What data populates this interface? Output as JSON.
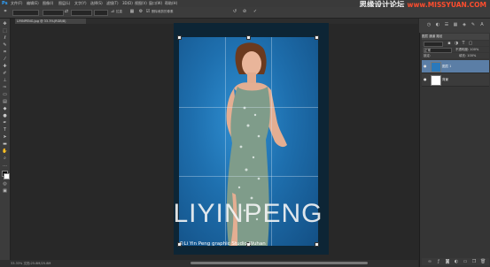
{
  "menubar": {
    "logo": "Ps",
    "items": [
      "文件(F)",
      "编辑(E)",
      "图像(I)",
      "图层(L)",
      "文字(Y)",
      "选择(S)",
      "滤镜(T)",
      "3D(D)",
      "视图(V)",
      "窗口(W)",
      "帮助(H)"
    ]
  },
  "watermark": {
    "left": "思缘设计论坛",
    "right": "www.MISSYUAN.COM"
  },
  "options": {
    "straighten_label": "拉直",
    "delete_cropped_label": "删除裁剪的像素"
  },
  "document_tab": {
    "label": "LIYINPENG.jpg @ 33.3%(RGB/8)"
  },
  "photo": {
    "title": "LIYINPENG",
    "credit": "©Li Yin Peng  graphic Studio Wuhan"
  },
  "status": {
    "text": "33.33%     文档:25.8M/25.8M"
  },
  "layers_panel": {
    "tab_label": "图层  通道  路径",
    "blend_mode": "正常",
    "opacity_label": "不透明度: 100%",
    "lock_label": "锁定:",
    "fill_label": "填充: 100%",
    "layers": [
      {
        "name": "图层 1",
        "selected": true
      },
      {
        "name": "背景",
        "selected": false
      }
    ]
  },
  "colors": {
    "accent": "#2fa3ff",
    "selected_layer": "#5b7ea6",
    "watermark_red": "#ff4d2e"
  }
}
